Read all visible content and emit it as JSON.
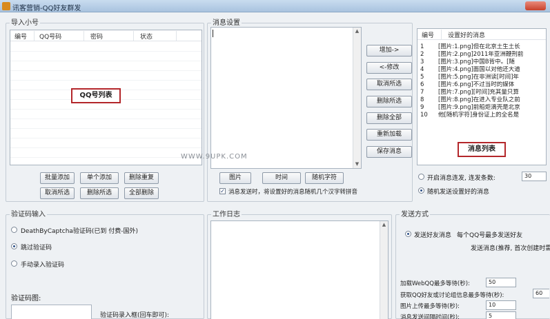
{
  "window": {
    "title": "讯客营销-QQ好友群发"
  },
  "import_group": {
    "label": "导入小号",
    "columns": [
      "编号",
      "QQ号码",
      "密码",
      "状态"
    ],
    "annotation": "QQ号列表",
    "buttons": [
      "批量添加",
      "单个添加",
      "删除重复",
      "取消所选",
      "删除所选",
      "全部删除"
    ]
  },
  "message_settings": {
    "label": "消息设置",
    "editor_value": "",
    "insert_buttons": [
      "图片",
      "时间",
      "随机字符"
    ],
    "random_space_checkbox": {
      "checked": true,
      "label": "消息发送时，将设置好的消息随机几个汉字转拼音"
    }
  },
  "action_buttons": [
    "增加->",
    "<-修改",
    "取消所选",
    "删除所选",
    "删除全部",
    "重新加载",
    "保存消息"
  ],
  "message_list": {
    "columns": [
      "编号",
      "设置好的消息"
    ],
    "rows": [
      {
        "num": "1",
        "text": "[图片:1.png]但在北京土生土长"
      },
      {
        "num": "2",
        "text": "[图片:2.png]2011年亚洲鞭刑前"
      },
      {
        "num": "3",
        "text": "[图片:3.png]中国B背中。[随"
      },
      {
        "num": "4",
        "text": "[图片:4.png]面国以对他还大道"
      },
      {
        "num": "5",
        "text": "[图片:5.png]在非洲读[时间]年"
      },
      {
        "num": "6",
        "text": "[图片:6.png]不过当时的媒体"
      },
      {
        "num": "7",
        "text": "[图片:7.png][时间]充其量只算"
      },
      {
        "num": "8",
        "text": "[图片:8.png]在进入专业队之前"
      },
      {
        "num": "9",
        "text": "[图片:9.png]前船炬滴壳是北京"
      },
      {
        "num": "10",
        "text": "他[随机字符]身份证上的全名是"
      }
    ],
    "annotation": "消息列表"
  },
  "send_mode_options": {
    "continuous": {
      "label": "开启消息连发, 连发条数:",
      "value": "30",
      "selected": false
    },
    "random": {
      "label": "随机发送设置好的消息",
      "selected": true
    }
  },
  "captcha_group": {
    "label": "验证码输入",
    "options": [
      {
        "label": "DeathByCaptcha验证码(已到 付费-国外)",
        "selected": false
      },
      {
        "label": "跳过验证码",
        "selected": true
      },
      {
        "label": "手动录入验证码",
        "selected": false
      }
    ],
    "image_label": "验证码图:",
    "input_label": "验证码录入框(回车即可):"
  },
  "work_log": {
    "label": "工作日志"
  },
  "send_method": {
    "label": "发送方式",
    "option": {
      "label": "发送好友消息",
      "selected": true
    },
    "note": "每个QQ号最多发送好友",
    "note2": "发送消息(推荐, 首次创建时需",
    "fields": [
      {
        "label": "加载WebQQ最多等待(秒):",
        "value": "50"
      },
      {
        "label": "获取QQ好友或讨论组信息最多等待(秒):",
        "value": "60"
      },
      {
        "label": "图片上传最多等待(秒):",
        "value": "10"
      },
      {
        "label": "消息发送间隔时间(秒):",
        "value": "5"
      }
    ]
  },
  "watermark": "WWW.9UPK.COM"
}
